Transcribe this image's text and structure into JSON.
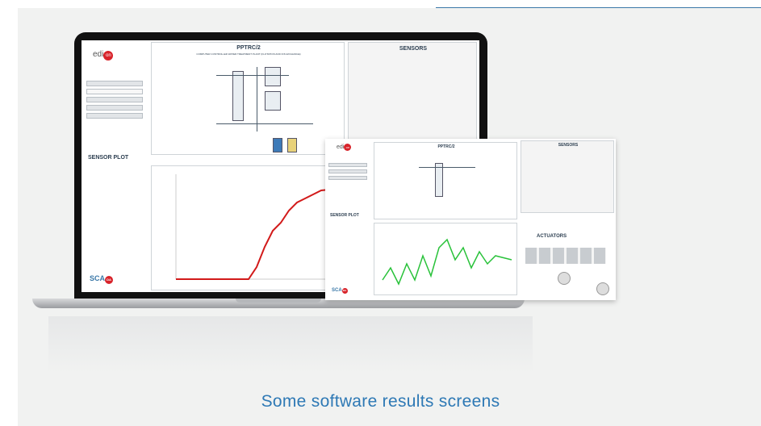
{
  "caption": "Some software results screens",
  "screen_main": {
    "title": "PPTRC/2",
    "subtitle": "COMPUTER CONTROLLED WATER TREATMENT PLANT (FLOTATION AND ION EXCHANGE)",
    "logo_left": "edi",
    "logo_o": "on",
    "sensors_title": "SENSORS",
    "plot_title": "SENSOR PLOT",
    "scada_logo": "SCA",
    "scada_o": "DA",
    "chart_color": "#d21a1a"
  },
  "screen_secondary": {
    "title": "PPTRC/2",
    "sensors_title": "SENSORS",
    "plot_title": "SENSOR PLOT",
    "actuators_title": "ACTUATORS",
    "logo_left": "edi",
    "logo_o": "on",
    "scada_logo": "SCA",
    "scada_o": "DA",
    "chart_color": "#29c23a"
  }
}
